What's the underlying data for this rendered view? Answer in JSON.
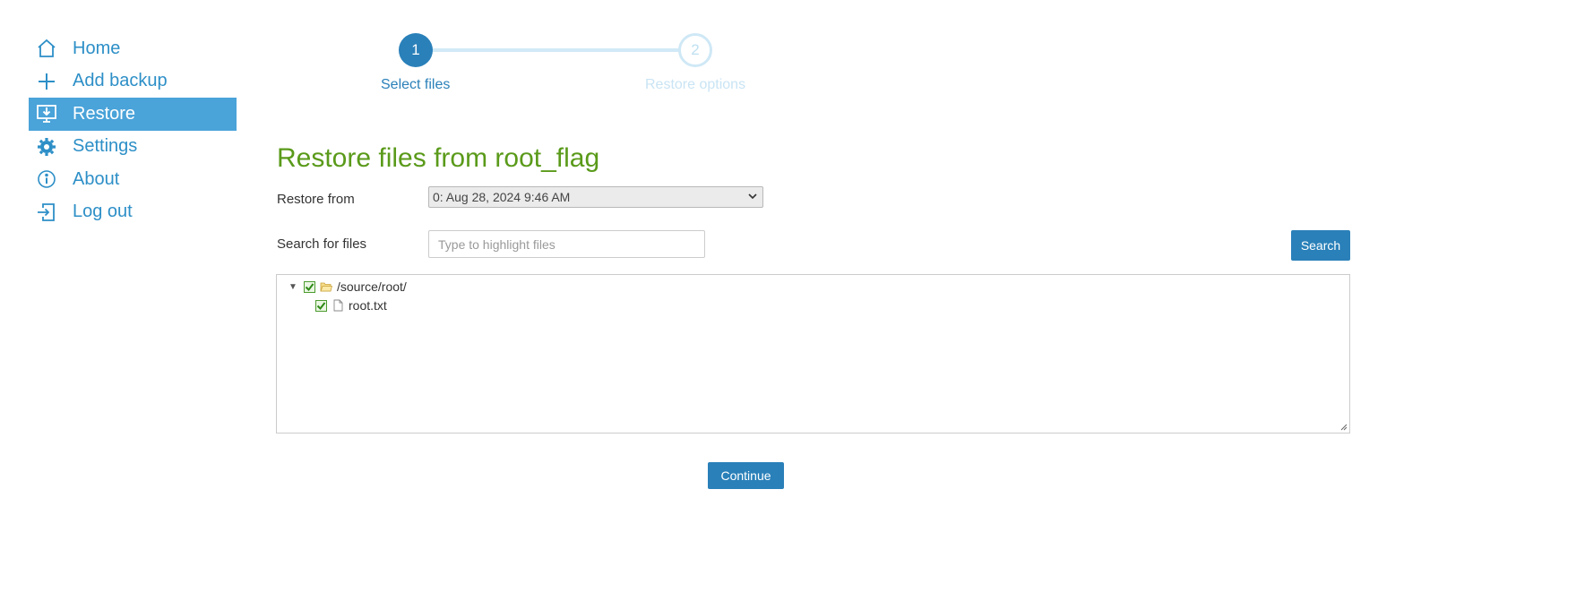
{
  "nav": {
    "items": [
      {
        "label": "Home",
        "icon": "home-icon"
      },
      {
        "label": "Add backup",
        "icon": "plus-icon"
      },
      {
        "label": "Restore",
        "icon": "restore-monitor-icon",
        "active": true
      },
      {
        "label": "Settings",
        "icon": "gear-icon"
      },
      {
        "label": "About",
        "icon": "info-icon"
      },
      {
        "label": "Log out",
        "icon": "logout-icon"
      }
    ]
  },
  "stepper": {
    "steps": [
      {
        "number": "1",
        "label": "Select files",
        "state": "active"
      },
      {
        "number": "2",
        "label": "Restore options",
        "state": "inactive"
      }
    ]
  },
  "main": {
    "title": "Restore files from root_flag",
    "restore_from_label": "Restore from",
    "restore_from_value": "0: Aug 28, 2024 9:46 AM",
    "search_label": "Search for files",
    "search_placeholder": "Type to highlight files",
    "search_button": "Search",
    "continue_button": "Continue"
  },
  "tree": {
    "root": {
      "label": "/source/root/",
      "checked": true,
      "expanded": true
    },
    "children": [
      {
        "label": "root.txt",
        "checked": true
      }
    ]
  },
  "colors": {
    "accent": "#2a80b9",
    "nav_active_bg": "#4aa3d9",
    "title_green": "#5a9a1a"
  }
}
